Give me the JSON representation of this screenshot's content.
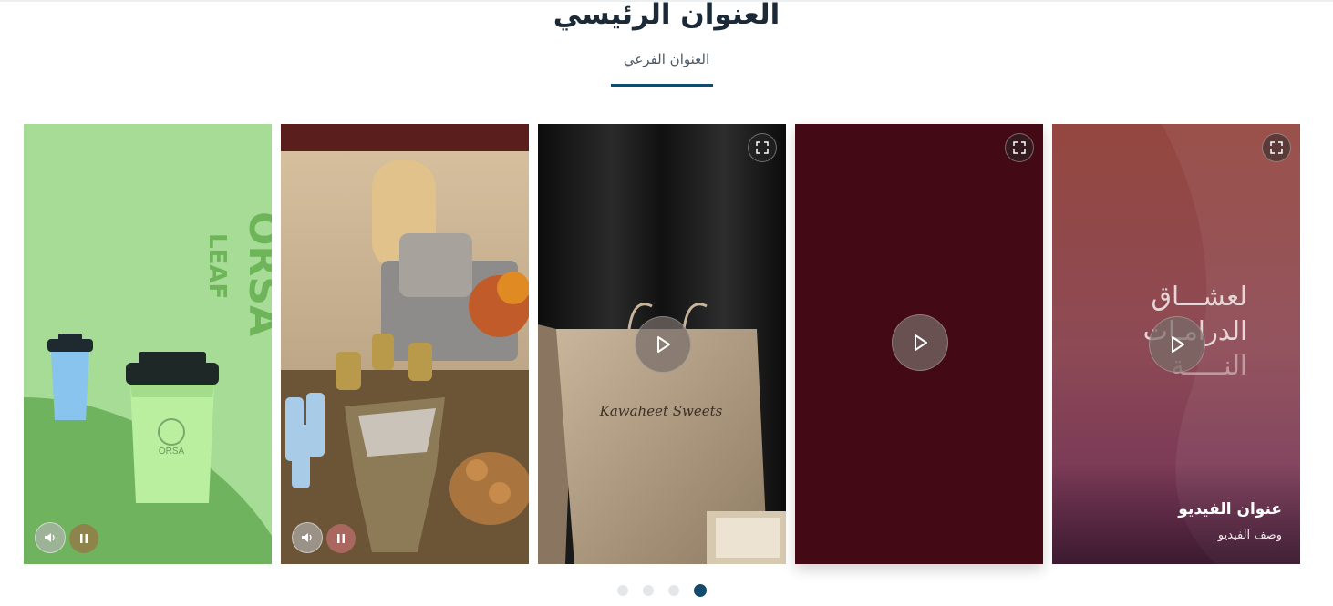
{
  "header": {
    "title": "العنوان الرئيسي",
    "subtitle": "العنوان الفرعي",
    "accent_color": "#114c6e"
  },
  "cards": [
    {
      "id": "orsa",
      "brand_text": "ORSA",
      "brand_sub": "LEAF",
      "cup_logo": "ORSA",
      "bg_color": "#a6dc96",
      "controls": [
        "sound-icon",
        "pause-icon"
      ]
    },
    {
      "id": "majlis",
      "bg_color": "#7a6a55",
      "controls": [
        "sound-icon",
        "pause-icon"
      ]
    },
    {
      "id": "gift-bag",
      "bag_script": "Kawaheet Sweets",
      "bg_color": "#141414",
      "controls": [
        "fullscreen-icon",
        "play-icon"
      ]
    },
    {
      "id": "maroon",
      "bg_color": "#430a16",
      "controls": [
        "fullscreen-icon",
        "play-icon"
      ]
    },
    {
      "id": "poster",
      "bg_color": "#8e4a4f",
      "overlay_lines": [
        "لعشـــاق",
        "الدرامـات",
        "النـــــة"
      ],
      "video_title": "عنوان الفيديو",
      "video_desc": "وصف الفيديو",
      "controls": [
        "fullscreen-icon",
        "play-icon"
      ]
    }
  ],
  "pagination": {
    "count": 4,
    "active_index": 3
  }
}
